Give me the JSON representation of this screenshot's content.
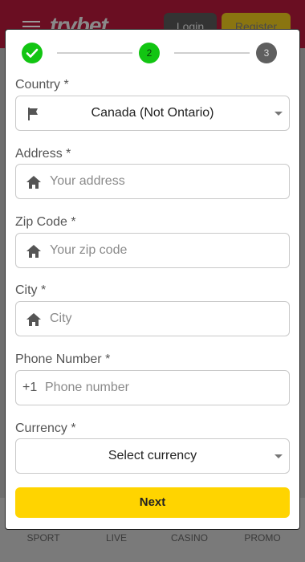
{
  "background": {
    "brand": "trybet",
    "login_label": "Login",
    "register_label": "Register",
    "nav": [
      "SPORT",
      "LIVE",
      "CASINO",
      "PROMO"
    ]
  },
  "stepper": {
    "step1": "",
    "step2": "2",
    "step3": "3",
    "current": 2
  },
  "form": {
    "country": {
      "label": "Country *",
      "value": "Canada (Not Ontario)",
      "icon": "flag-icon"
    },
    "address": {
      "label": "Address *",
      "placeholder": "Your address",
      "icon": "home-icon"
    },
    "zip": {
      "label": "Zip Code *",
      "placeholder": "Your zip code",
      "icon": "home-icon"
    },
    "city": {
      "label": "City *",
      "placeholder": "City",
      "icon": "home-icon"
    },
    "phone": {
      "label": "Phone Number *",
      "prefix": "+1",
      "placeholder": "Phone number"
    },
    "currency": {
      "label": "Currency *",
      "value": "Select currency"
    },
    "next_label": "Next"
  },
  "colors": {
    "accent": "#ffd400",
    "step_complete": "#12c512",
    "step_pending": "#5f5f5f"
  }
}
